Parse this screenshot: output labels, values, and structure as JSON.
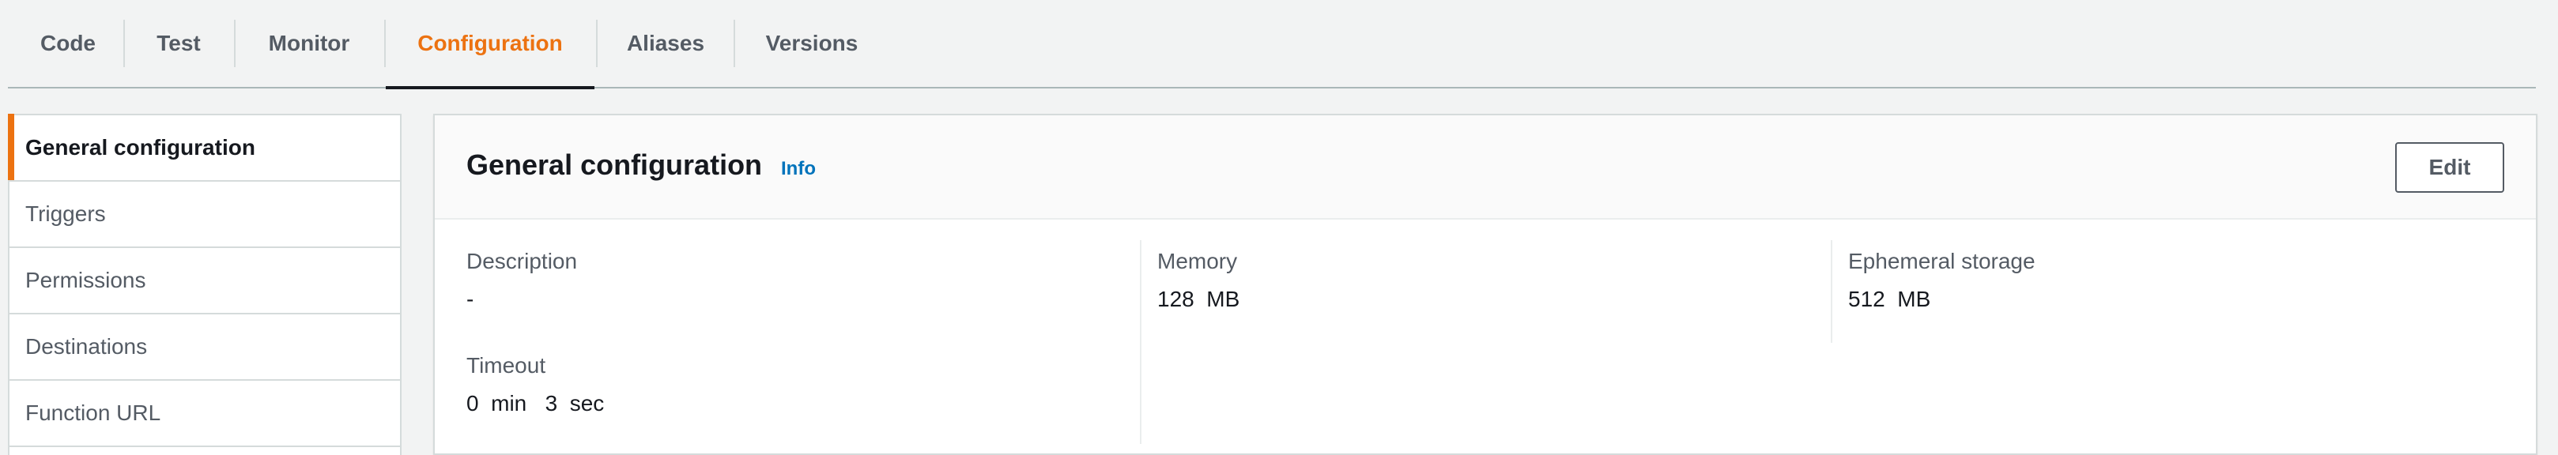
{
  "tabs": [
    {
      "label": "Code"
    },
    {
      "label": "Test"
    },
    {
      "label": "Monitor"
    },
    {
      "label": "Configuration"
    },
    {
      "label": "Aliases"
    },
    {
      "label": "Versions"
    }
  ],
  "active_tab": "Configuration",
  "sidebar": {
    "items": [
      {
        "label": "General configuration"
      },
      {
        "label": "Triggers"
      },
      {
        "label": "Permissions"
      },
      {
        "label": "Destinations"
      },
      {
        "label": "Function URL"
      }
    ],
    "active_item": "General configuration"
  },
  "panel": {
    "title": "General configuration",
    "info_label": "Info",
    "edit_label": "Edit",
    "fields": {
      "description": {
        "label": "Description",
        "value": "-"
      },
      "memory": {
        "label": "Memory",
        "value": "128  MB"
      },
      "ephemeral_storage": {
        "label": "Ephemeral storage",
        "value": "512  MB"
      },
      "timeout": {
        "label": "Timeout",
        "value": "0  min   3  sec"
      }
    }
  },
  "colors": {
    "accent": "#ec7211",
    "link": "#0073bb",
    "text": "#16191f",
    "muted_text": "#545b64",
    "background": "#f2f3f3",
    "border": "#d5dbdb"
  }
}
